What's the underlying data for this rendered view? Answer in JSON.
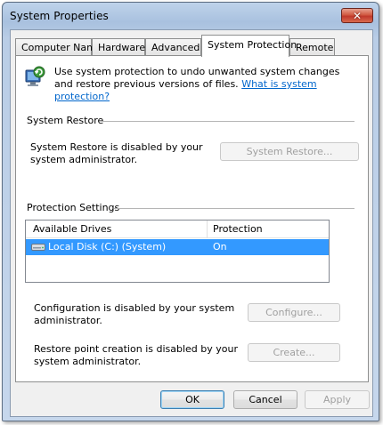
{
  "window": {
    "title": "System Properties",
    "close_label": "✕"
  },
  "tabs": [
    {
      "label": "Computer Name"
    },
    {
      "label": "Hardware"
    },
    {
      "label": "Advanced"
    },
    {
      "label": "System Protection"
    },
    {
      "label": "Remote"
    }
  ],
  "intro": {
    "text": "Use system protection to undo unwanted system changes and restore previous versions of files.",
    "link": "What is system protection?",
    "icon": "system-protection-icon"
  },
  "system_restore": {
    "heading": "System Restore",
    "message": "System Restore is disabled by your system administrator.",
    "button": "System Restore..."
  },
  "protection_settings": {
    "heading": "Protection Settings",
    "columns": [
      "Available Drives",
      "Protection"
    ],
    "drives": [
      {
        "name": "Local Disk (C:) (System)",
        "protection": "On",
        "icon": "hard-drive-icon",
        "selected": true
      }
    ],
    "configure_message": "Configuration is disabled by your system administrator.",
    "configure_button": "Configure...",
    "create_message": "Restore point creation is disabled by your system administrator.",
    "create_button": "Create..."
  },
  "footer": {
    "ok": "OK",
    "cancel": "Cancel",
    "apply": "Apply"
  },
  "colors": {
    "selection": "#3399ff",
    "link": "#0066cc",
    "disabled_text": "#a0a0a0"
  }
}
